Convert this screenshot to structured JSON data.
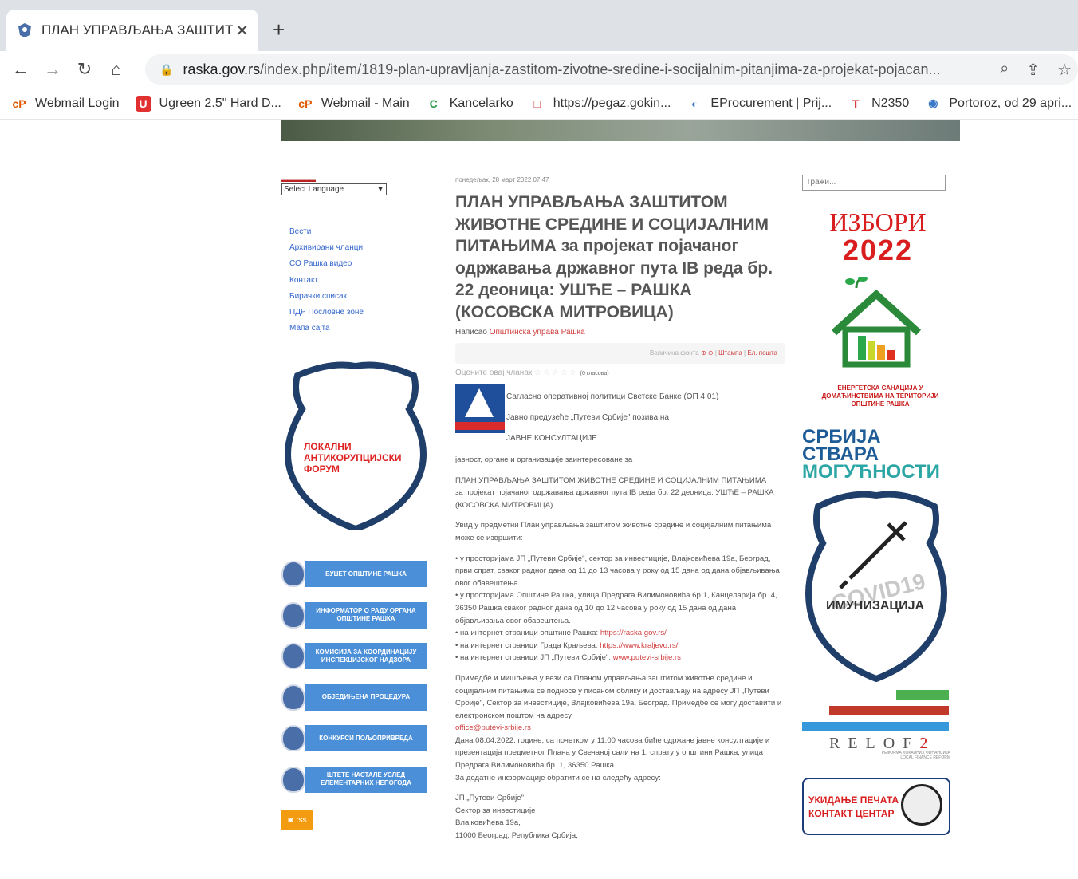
{
  "browser": {
    "tab_title": "ПЛАН УПРАВЉАЊА ЗАШТИТО",
    "tab_close": "✕",
    "new_tab": "+",
    "url_domain": "raska.gov.rs",
    "url_path": "/index.php/item/1819-plan-upravljanja-zastitom-zivotne-sredine-i-socijalnim-pitanjima-za-projekat-pojacan...",
    "bookmarks": [
      {
        "label": "Webmail Login",
        "icon": "cP"
      },
      {
        "label": "Ugreen 2.5\" Hard D...",
        "icon": "U"
      },
      {
        "label": "Webmail - Main",
        "icon": "cP"
      },
      {
        "label": "Kancelarko",
        "icon": "C"
      },
      {
        "label": "https://pegaz.gokin...",
        "icon": "□"
      },
      {
        "label": "EProcurement | Prij...",
        "icon": "◐"
      },
      {
        "label": "N2350",
        "icon": "T"
      },
      {
        "label": "Portoroz, od 29 apri...",
        "icon": "◉"
      }
    ]
  },
  "left": {
    "language_select": "Select Language",
    "menu": [
      "Вести",
      "Архивирани чланци",
      "СО Рашка видео",
      "Контакт",
      "Бирачки списак",
      "ПДР Пословне зоне",
      "Мапа сајта"
    ],
    "anticorruption": [
      "ЛОКАЛНИ",
      "АНТИКОРУПЦИЈСКИ",
      "ФОРУМ"
    ],
    "buttons": [
      "БУЏЕТ ОПШТИНЕ РАШКА",
      "ИНФОРМАТОР О РАДУ ОРГАНА ОПШТИНЕ РАШКА",
      "КОМИСИЈА ЗА КООРДИНАЦИЈУ ИНСПЕКЦИЈСКОГ НАДЗОРА",
      "ОБЈЕДИЊЕНА ПРОЦЕДУРА",
      "КОНКУРСИ ПОЉОПРИВРЕДА",
      "ШТЕТЕ НАСТАЛЕ УСЛЕД ЕЛЕМЕНТАРНИХ НЕПОГОДА"
    ],
    "rss": "rss"
  },
  "article": {
    "date": "понедељак, 28 март 2022 07:47",
    "title": "ПЛАН УПРАВЉАЊА ЗАШТИТОМ ЖИВОТНЕ СРЕДИНЕ И СОЦИЈАЛНИМ ПИТАЊИМА за пројекат појачаног одржавања државног пута IB реда бр. 22 деоница: УШЋЕ – РАШКА (КОСОВСКА МИТРОВИЦА)",
    "author_prefix": "Написао",
    "author": "Општинска управа Рашка",
    "tools_font": "Величина фонта",
    "tools_print": "Штампа",
    "tools_email": "Ел. пошта",
    "rate_label": "Оцените овај чланак",
    "rate_stars": "☆☆☆☆☆",
    "rate_count": "(0 гласова)",
    "logo_lines": [
      "Сагласно оперативној политици Светске Банке (ОП 4.01)",
      "Јавно предузеће „Путеви Србије\" позива на",
      "ЈАВНЕ КОНСУЛТАЦИЈЕ"
    ],
    "p1": "јавност, органе и организације заинтересоване за",
    "p2a": "ПЛАН УПРАВЉАЊА ЗАШТИТОМ ЖИВОТНЕ СРЕДИНЕ И СОЦИЈАЛНИМ ПИТАЊИМА",
    "p2b": "за пројекат појачаног одржавања државног пута IB реда бр. 22 деоница: УШЋЕ – РАШКА (КОСОВСКА МИТРОВИЦА)",
    "p3": "Увид у предметни План управљања заштитом животне средине и социјалним питањима може се извршити:",
    "b1": "• у просторијама ЈП „Путеви Србије\", сектор за инвестиције, Влајковићева 19а, Београд, први спрат, сваког радног дана од 11 до 13 часова у року од 15 дана од дана објављивања овог обавештења.",
    "b2": "• у просторијама Општине Рашка, улица Предрага Вилимоновића 6р.1, Канцеларија бр. 4, 36350 Рашка сваког радног дана од 10 до 12 часова у року од 15 дана од дана објављивања овог обавештења.",
    "b3_prefix": "• на интернет страници општине Рашка: ",
    "b3_link": "https://raska.gov.rs/",
    "b4_prefix": "• на интернет страници Града Краљева: ",
    "b4_link": "https://www.kraljevo.rs/",
    "b5_prefix": "• на интернет страници ЈП „Путеви Србије\": ",
    "b5_link": "www.putevi-srbije.rs",
    "p4": "Примедбе и мишљења у вези са Планом управљања заштитом животне средине и социјалним питањима се подносе у писаном облику и достављају на адресу ЈП „Путеви Србије\", Сектор за инвестиције, Влајковићева 19а, Београд. Примедбе се могу доставити и електронском поштом на адресу",
    "p4_link": "office@putevi-srbije.rs",
    "p5": "Дана 08.04.2022. године, са почетком у 11:00 часова биће одржане јавне консултације и презентација предметног Плана у Свечаној сали на 1. спрату у општини Рашка, улица Предрага Вилимоновића бр. 1, 36350 Рашка.",
    "p6": "За додатне информације обратити се на следећу адресу:",
    "addr1": "ЈП „Путеви Србије\"",
    "addr2": "Сектор за инвестиције",
    "addr3": "Влајковићева 19а,",
    "addr4": "11000 Београд, Република Србија,"
  },
  "right": {
    "search_placeholder": "Тражи...",
    "izbori": "ИЗБОРИ",
    "year": "2022",
    "energy_label": "ЕНЕРГЕТСКА САНАЦИЈА У ДОМАЋИНСТВИМА НА ТЕРИТОРИЈИ ОПШТИНЕ РАШКА",
    "srbija1": "СРБИЈА",
    "srbija2": "СТВАРА",
    "srbija3": "МОГУЋНОСТИ",
    "immun": "ИМУНИЗАЦИЈА",
    "covid": "COVID19",
    "relof": "RELOF",
    "relof_num": "2",
    "relof_sub1": "РЕФОРМА ЛОКАЛНИХ ФИНАНСИЈА",
    "relof_sub2": "LOCAL FINANCE REFORM",
    "ukidanje1": "УКИДАЊЕ ПЕЧАТА",
    "ukidanje2": "КОНТАКТ ЦЕНТАР"
  }
}
